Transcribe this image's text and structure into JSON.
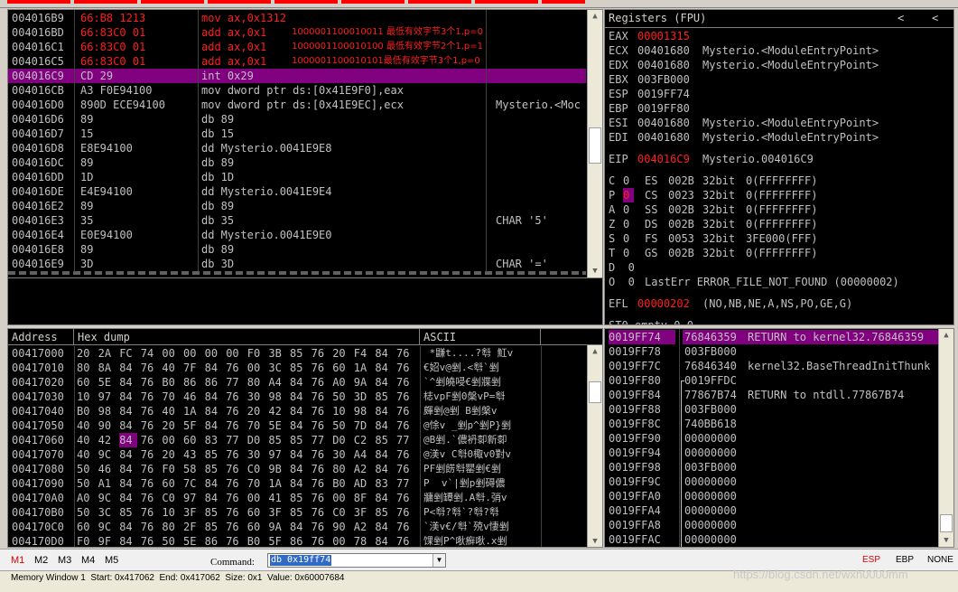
{
  "colors": {
    "accent": "#800080",
    "changed": "#ff1e1e",
    "text": "#c0c0c0",
    "panel_bg": "#000000"
  },
  "top_strip": {
    "color": "#ff0000"
  },
  "disasm": {
    "current_address": "004016C9",
    "rows": [
      {
        "addr": "004016B9",
        "hex": "66:B8 1213",
        "asm": "mov ax,0x1312",
        "comment": "",
        "note": "",
        "red": true
      },
      {
        "addr": "004016BD",
        "hex": "66:83C0 01",
        "asm": "add ax,0x1",
        "comment": "",
        "note": "1000001100010011 最低有效字节3个1,p=0",
        "red": true
      },
      {
        "addr": "004016C1",
        "hex": "66:83C0 01",
        "asm": "add ax,0x1",
        "comment": "",
        "note": "1000001100010100 最低有效字节2个1,p=1",
        "red": true
      },
      {
        "addr": "004016C5",
        "hex": "66:83C0 01",
        "asm": "add ax,0x1",
        "comment": "",
        "note": "1000001100010101最低有效字节3个1,p=0",
        "red": true
      },
      {
        "addr": "004016C9",
        "hex": "CD 29",
        "asm": "int 0x29",
        "comment": "",
        "note": "",
        "red": false,
        "selected": true
      },
      {
        "addr": "004016CB",
        "hex": "A3 F0E94100",
        "asm": "mov dword ptr ds:[0x41E9F0],eax",
        "comment": "",
        "note": "",
        "red": false
      },
      {
        "addr": "004016D0",
        "hex": "890D ECE94100",
        "asm": "mov dword ptr ds:[0x41E9EC],ecx",
        "comment": "Mysterio.<Moc",
        "note": "",
        "red": false
      },
      {
        "addr": "004016D6",
        "hex": "89",
        "asm": "db 89",
        "comment": "",
        "note": "",
        "red": false
      },
      {
        "addr": "004016D7",
        "hex": "15",
        "asm": "db 15",
        "comment": "",
        "note": "",
        "red": false
      },
      {
        "addr": "004016D8",
        "hex": "E8E94100",
        "asm": "dd Mysterio.0041E9E8",
        "comment": "",
        "note": "",
        "red": false
      },
      {
        "addr": "004016DC",
        "hex": "89",
        "asm": "db 89",
        "comment": "",
        "note": "",
        "red": false
      },
      {
        "addr": "004016DD",
        "hex": "1D",
        "asm": "db 1D",
        "comment": "",
        "note": "",
        "red": false
      },
      {
        "addr": "004016DE",
        "hex": "E4E94100",
        "asm": "dd Mysterio.0041E9E4",
        "comment": "",
        "note": "",
        "red": false
      },
      {
        "addr": "004016E2",
        "hex": "89",
        "asm": "db 89",
        "comment": "",
        "note": "",
        "red": false
      },
      {
        "addr": "004016E3",
        "hex": "35",
        "asm": "db 35",
        "comment": "CHAR '5'",
        "note": "",
        "red": false
      },
      {
        "addr": "004016E4",
        "hex": "E0E94100",
        "asm": "dd Mysterio.0041E9E0",
        "comment": "",
        "note": "",
        "red": false
      },
      {
        "addr": "004016E8",
        "hex": "89",
        "asm": "db 89",
        "comment": "",
        "note": "",
        "red": false
      },
      {
        "addr": "004016E9",
        "hex": "3D",
        "asm": "db 3D",
        "comment": "CHAR '='",
        "note": "",
        "red": false
      }
    ]
  },
  "registers": {
    "title": "Registers (FPU)",
    "nav_left": "<",
    "nav_right": "<",
    "gp": [
      {
        "name": "EAX",
        "value": "00001315",
        "desc": "",
        "changed": true
      },
      {
        "name": "ECX",
        "value": "00401680",
        "desc": "Mysterio.<ModuleEntryPoint>",
        "changed": false
      },
      {
        "name": "EDX",
        "value": "00401680",
        "desc": "Mysterio.<ModuleEntryPoint>",
        "changed": false
      },
      {
        "name": "EBX",
        "value": "003FB000",
        "desc": "",
        "changed": false
      },
      {
        "name": "ESP",
        "value": "0019FF74",
        "desc": "",
        "changed": false
      },
      {
        "name": "EBP",
        "value": "0019FF80",
        "desc": "",
        "changed": false
      },
      {
        "name": "ESI",
        "value": "00401680",
        "desc": "Mysterio.<ModuleEntryPoint>",
        "changed": false
      },
      {
        "name": "EDI",
        "value": "00401680",
        "desc": "Mysterio.<ModuleEntryPoint>",
        "changed": false
      }
    ],
    "eip": {
      "name": "EIP",
      "value": "004016C9",
      "desc": "Mysterio.004016C9"
    },
    "flags": [
      {
        "flag": "C",
        "bit": "0",
        "seg": "ES",
        "sel": "002B",
        "bits": "32bit",
        "base": "0(FFFFFFFF)",
        "hl": false
      },
      {
        "flag": "P",
        "bit": "0",
        "seg": "CS",
        "sel": "0023",
        "bits": "32bit",
        "base": "0(FFFFFFFF)",
        "hl": true
      },
      {
        "flag": "A",
        "bit": "0",
        "seg": "SS",
        "sel": "002B",
        "bits": "32bit",
        "base": "0(FFFFFFFF)",
        "hl": false
      },
      {
        "flag": "Z",
        "bit": "0",
        "seg": "DS",
        "sel": "002B",
        "bits": "32bit",
        "base": "0(FFFFFFFF)",
        "hl": false
      },
      {
        "flag": "S",
        "bit": "0",
        "seg": "FS",
        "sel": "0053",
        "bits": "32bit",
        "base": "3FE000(FFF)",
        "hl": false
      },
      {
        "flag": "T",
        "bit": "0",
        "seg": "GS",
        "sel": "002B",
        "bits": "32bit",
        "base": "0(FFFFFFFF)",
        "hl": false
      }
    ],
    "flag_d": "D  0",
    "flag_o": "O  0",
    "lasterr": "LastErr ERROR_FILE_NOT_FOUND (00000002)",
    "efl_label": "EFL",
    "efl_value": "00000202",
    "efl_desc": "(NO,NB,NE,A,NS,PO,GE,G)",
    "st0": "ST0 empty 0.0"
  },
  "dump": {
    "col_address": "Address",
    "col_hex": "Hex dump",
    "col_ascii": "ASCII",
    "rows": [
      {
        "addr": "00417000",
        "bytes": [
          "20",
          "2A",
          "FC",
          "74",
          "00",
          "00",
          "00",
          "00",
          "F0",
          "3B",
          "85",
          "76",
          "20",
          "F4",
          "84",
          "76"
        ],
        "ascii": " *鼸t....?厁 魟v"
      },
      {
        "addr": "00417010",
        "bytes": [
          "80",
          "8A",
          "84",
          "76",
          "40",
          "7F",
          "84",
          "76",
          "00",
          "3C",
          "85",
          "76",
          "60",
          "1A",
          "84",
          "76"
        ],
        "ascii": "€妱v@剉.<厁`剉"
      },
      {
        "addr": "00417020",
        "bytes": [
          "60",
          "5E",
          "84",
          "76",
          "B0",
          "86",
          "86",
          "77",
          "80",
          "A4",
          "84",
          "76",
          "A0",
          "9A",
          "84",
          "76"
        ],
        "ascii": "`^剉皢唚€剉牃剉"
      },
      {
        "addr": "00417030",
        "bytes": [
          "10",
          "97",
          "84",
          "76",
          "70",
          "46",
          "84",
          "76",
          "30",
          "98",
          "84",
          "76",
          "50",
          "3D",
          "85",
          "76"
        ],
        "ascii": "梽vpF剉0槃vP=厁"
      },
      {
        "addr": "00417040",
        "bytes": [
          "B0",
          "98",
          "84",
          "76",
          "40",
          "1A",
          "84",
          "76",
          "20",
          "42",
          "84",
          "76",
          "10",
          "98",
          "84",
          "76"
        ],
        "ascii": "皹剉@剉 B剉槃v"
      },
      {
        "addr": "00417050",
        "bytes": [
          "40",
          "90",
          "84",
          "76",
          "20",
          "5F",
          "84",
          "76",
          "70",
          "5E",
          "84",
          "76",
          "50",
          "7D",
          "84",
          "76"
        ],
        "ascii": "@悇v _剉p^剉P}剉"
      },
      {
        "addr": "00417060",
        "bytes": [
          "40",
          "42",
          "84",
          "76",
          "00",
          "60",
          "83",
          "77",
          "D0",
          "85",
          "85",
          "77",
          "D0",
          "C2",
          "85",
          "77"
        ],
        "ascii": "@B剉.`儂袇厀新厀",
        "hl": 2
      },
      {
        "addr": "00417070",
        "bytes": [
          "40",
          "9C",
          "84",
          "76",
          "20",
          "43",
          "85",
          "76",
          "30",
          "97",
          "84",
          "76",
          "30",
          "A4",
          "84",
          "76"
        ],
        "ascii": "@渼v C厁0棷v0對v"
      },
      {
        "addr": "00417080",
        "bytes": [
          "50",
          "46",
          "84",
          "76",
          "F0",
          "58",
          "85",
          "76",
          "C0",
          "9B",
          "84",
          "76",
          "80",
          "A2",
          "84",
          "76"
        ],
        "ascii": "PF剉餝厁罌剉€剉"
      },
      {
        "addr": "00417090",
        "bytes": [
          "50",
          "A1",
          "84",
          "76",
          "60",
          "7C",
          "84",
          "76",
          "70",
          "1A",
          "84",
          "76",
          "B0",
          "AD",
          "83",
          "77"
        ],
        "ascii": "P  v`|剉p剉碍儂"
      },
      {
        "addr": "004170A0",
        "bytes": [
          "A0",
          "9C",
          "84",
          "76",
          "C0",
          "97",
          "84",
          "76",
          "00",
          "41",
          "85",
          "76",
          "00",
          "8F",
          "84",
          "76"
        ],
        "ascii": "牅剉罈剉.A厁.弰v"
      },
      {
        "addr": "004170B0",
        "bytes": [
          "50",
          "3C",
          "85",
          "76",
          "10",
          "3F",
          "85",
          "76",
          "60",
          "3F",
          "85",
          "76",
          "C0",
          "3F",
          "85",
          "76"
        ],
        "ascii": "P<厁?厁`?厁?厁"
      },
      {
        "addr": "004170C0",
        "bytes": [
          "60",
          "9C",
          "84",
          "76",
          "80",
          "2F",
          "85",
          "76",
          "60",
          "9A",
          "84",
          "76",
          "90",
          "A2",
          "84",
          "76"
        ],
        "ascii": "`渼v€/厁`殑v悽剉"
      },
      {
        "addr": "004170D0",
        "bytes": [
          "F0",
          "9F",
          "84",
          "76",
          "50",
          "5E",
          "86",
          "76",
          "B0",
          "5F",
          "86",
          "76",
          "00",
          "78",
          "84",
          "76"
        ],
        "ascii": "馃剉P^唙癬唙.x剉"
      }
    ]
  },
  "stack": {
    "rows": [
      {
        "addr": "0019FF74",
        "value": "76846359",
        "comment": "RETURN to kernel32.76846359",
        "selected": true
      },
      {
        "addr": "0019FF78",
        "value": "003FB000",
        "comment": ""
      },
      {
        "addr": "0019FF7C",
        "value": "76846340",
        "comment": "kernel32.BaseThreadInitThunk"
      },
      {
        "addr": "0019FF80",
        "value": "0019FFDC",
        "comment": "",
        "bracket": "top"
      },
      {
        "addr": "0019FF84",
        "value": "77867B74",
        "comment": "RETURN to ntdll.77867B74",
        "bracket": "mid"
      },
      {
        "addr": "0019FF88",
        "value": "003FB000",
        "comment": "",
        "bracket": "mid"
      },
      {
        "addr": "0019FF8C",
        "value": "740BB618",
        "comment": "",
        "bracket": "mid"
      },
      {
        "addr": "0019FF90",
        "value": "00000000",
        "comment": "",
        "bracket": "mid"
      },
      {
        "addr": "0019FF94",
        "value": "00000000",
        "comment": "",
        "bracket": "mid"
      },
      {
        "addr": "0019FF98",
        "value": "003FB000",
        "comment": "",
        "bracket": "mid"
      },
      {
        "addr": "0019FF9C",
        "value": "00000000",
        "comment": "",
        "bracket": "mid"
      },
      {
        "addr": "0019FFA0",
        "value": "00000000",
        "comment": "",
        "bracket": "mid"
      },
      {
        "addr": "0019FFA4",
        "value": "00000000",
        "comment": "",
        "bracket": "mid"
      },
      {
        "addr": "0019FFA8",
        "value": "00000000",
        "comment": "",
        "bracket": "mid"
      },
      {
        "addr": "0019FFAC",
        "value": "00000000",
        "comment": "",
        "bracket": "mid"
      }
    ]
  },
  "command_bar": {
    "tabs": [
      "M1",
      "M2",
      "M3",
      "M4",
      "M5"
    ],
    "command_label": "Command:",
    "command_value": "db 0x19ff74",
    "right_buttons": [
      "ESP",
      "EBP",
      "NONE"
    ]
  },
  "status_bar": {
    "text": "Memory Window 1  Start: 0x417062  End: 0x417062  Size: 0x1  Value: 0x60007684",
    "watermark": "https://blog.csdn.net/wxh0000mm"
  }
}
